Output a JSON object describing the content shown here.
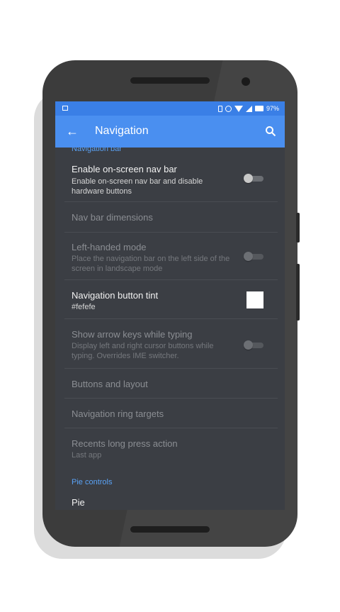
{
  "status_bar": {
    "battery": "97%"
  },
  "app_bar": {
    "title": "Navigation"
  },
  "sections": {
    "navigation_bar": "Navigation bar",
    "pie_controls": "Pie controls"
  },
  "items": {
    "enable_nav_bar": {
      "title": "Enable on-screen nav bar",
      "summary": "Enable on-screen nav bar and disable hardware buttons",
      "enabled": true,
      "checked": false
    },
    "nav_bar_dimensions": {
      "title": "Nav bar dimensions",
      "enabled": false
    },
    "left_handed_mode": {
      "title": "Left-handed mode",
      "summary": "Place the navigation bar on the left side of the screen in landscape mode",
      "enabled": false,
      "checked": false
    },
    "button_tint": {
      "title": "Navigation button tint",
      "summary": "#fefefe",
      "color": "#fefefe"
    },
    "arrow_keys": {
      "title": "Show arrow keys while typing",
      "summary": "Display left and right cursor buttons while typing. Overrides IME switcher.",
      "enabled": false,
      "checked": false
    },
    "buttons_layout": {
      "title": "Buttons and layout",
      "enabled": false
    },
    "ring_targets": {
      "title": "Navigation ring targets",
      "enabled": false
    },
    "recents_long_press": {
      "title": "Recents long press action",
      "summary": "Last app",
      "enabled": false
    },
    "pie": {
      "title": "Pie"
    }
  },
  "colors": {
    "status_bar": "#3a7fe6",
    "app_bar": "#4a8ff0",
    "background": "#3b3e44",
    "accent": "#5aa2f5"
  }
}
